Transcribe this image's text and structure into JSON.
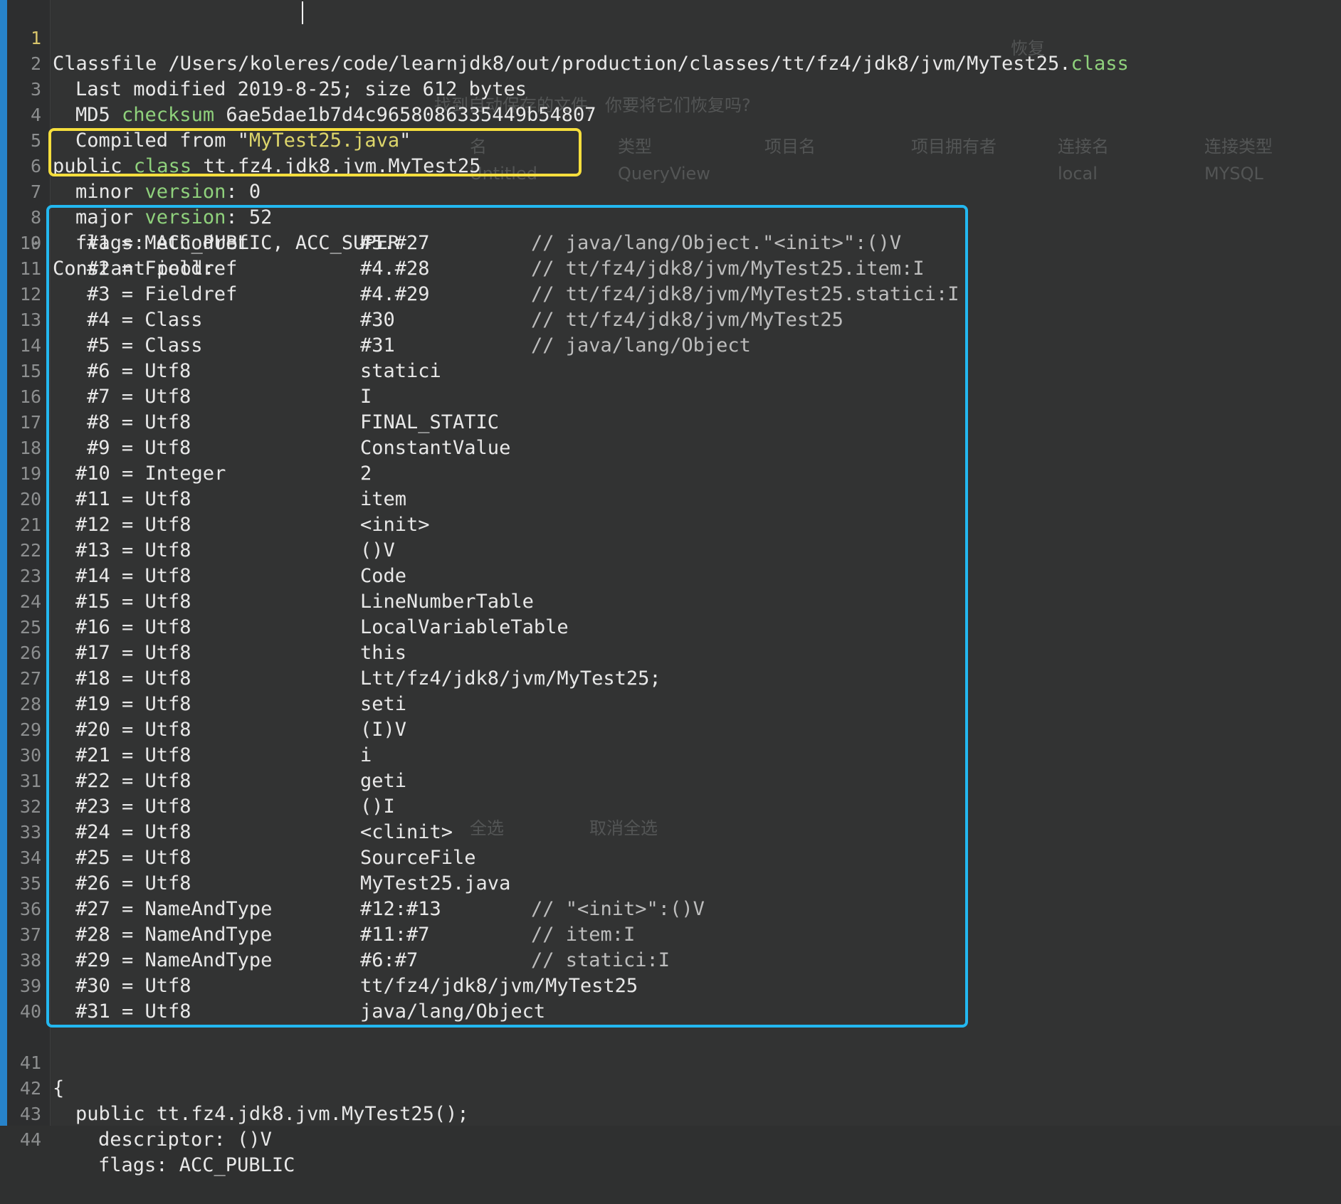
{
  "header_line": {
    "number": "1",
    "text_pre": "Classfile /Users/kole",
    "text_post": "res/code/learnjdk8/out/production/classes/tt/fz4/jdk8/jvm/MyTest25.",
    "text_kw": "class"
  },
  "meta": {
    "last_modified": "Last modified 2019-8-25; size 612 bytes",
    "md5_label": "MD5 ",
    "md5_kw": "checksum",
    "md5_value": " 6ae5dae1b7d4c9658086335449b54807",
    "compiled_pre": "Compiled from \"",
    "compiled_file": "MyTest25.java",
    "compiled_post": "\"",
    "class_pre": "public ",
    "class_kw": "class",
    "class_post": " tt.fz4.jdk8.jvm.MyTest25",
    "minor_pre": "minor ",
    "minor_kw": "version",
    "minor_post": ": 0",
    "major_pre": "major ",
    "major_kw": "version",
    "major_post": ": 52",
    "flags": "flags: ACC_PUBLIC, ACC_SUPER",
    "constant_pool": "Constant pool:"
  },
  "constant_pool": [
    {
      "idx": "#1",
      "type": "Methodref",
      "value": "#5.#27",
      "comment": "// java/lang/Object.\"<init>\":()V"
    },
    {
      "idx": "#2",
      "type": "Fieldref",
      "value": "#4.#28",
      "comment": "// tt/fz4/jdk8/jvm/MyTest25.item:I"
    },
    {
      "idx": "#3",
      "type": "Fieldref",
      "value": "#4.#29",
      "comment": "// tt/fz4/jdk8/jvm/MyTest25.statici:I"
    },
    {
      "idx": "#4",
      "type": "Class",
      "value": "#30",
      "comment": "// tt/fz4/jdk8/jvm/MyTest25"
    },
    {
      "idx": "#5",
      "type": "Class",
      "value": "#31",
      "comment": "// java/lang/Object"
    },
    {
      "idx": "#6",
      "type": "Utf8",
      "value": "statici",
      "comment": ""
    },
    {
      "idx": "#7",
      "type": "Utf8",
      "value": "I",
      "comment": ""
    },
    {
      "idx": "#8",
      "type": "Utf8",
      "value": "FINAL_STATIC",
      "comment": ""
    },
    {
      "idx": "#9",
      "type": "Utf8",
      "value": "ConstantValue",
      "comment": ""
    },
    {
      "idx": "#10",
      "type": "Integer",
      "value": "2",
      "comment": ""
    },
    {
      "idx": "#11",
      "type": "Utf8",
      "value": "item",
      "comment": ""
    },
    {
      "idx": "#12",
      "type": "Utf8",
      "value": "<init>",
      "comment": ""
    },
    {
      "idx": "#13",
      "type": "Utf8",
      "value": "()V",
      "comment": ""
    },
    {
      "idx": "#14",
      "type": "Utf8",
      "value": "Code",
      "comment": ""
    },
    {
      "idx": "#15",
      "type": "Utf8",
      "value": "LineNumberTable",
      "comment": ""
    },
    {
      "idx": "#16",
      "type": "Utf8",
      "value": "LocalVariableTable",
      "comment": ""
    },
    {
      "idx": "#17",
      "type": "Utf8",
      "value": "this",
      "comment": ""
    },
    {
      "idx": "#18",
      "type": "Utf8",
      "value": "Ltt/fz4/jdk8/jvm/MyTest25;",
      "comment": ""
    },
    {
      "idx": "#19",
      "type": "Utf8",
      "value": "seti",
      "comment": ""
    },
    {
      "idx": "#20",
      "type": "Utf8",
      "value": "(I)V",
      "comment": ""
    },
    {
      "idx": "#21",
      "type": "Utf8",
      "value": "i",
      "comment": ""
    },
    {
      "idx": "#22",
      "type": "Utf8",
      "value": "geti",
      "comment": ""
    },
    {
      "idx": "#23",
      "type": "Utf8",
      "value": "()I",
      "comment": ""
    },
    {
      "idx": "#24",
      "type": "Utf8",
      "value": "<clinit>",
      "comment": ""
    },
    {
      "idx": "#25",
      "type": "Utf8",
      "value": "SourceFile",
      "comment": ""
    },
    {
      "idx": "#26",
      "type": "Utf8",
      "value": "MyTest25.java",
      "comment": ""
    },
    {
      "idx": "#27",
      "type": "NameAndType",
      "value": "#12:#13",
      "comment": "// \"<init>\":()V"
    },
    {
      "idx": "#28",
      "type": "NameAndType",
      "value": "#11:#7",
      "comment": "// item:I"
    },
    {
      "idx": "#29",
      "type": "NameAndType",
      "value": "#6:#7",
      "comment": "// statici:I"
    },
    {
      "idx": "#30",
      "type": "Utf8",
      "value": "tt/fz4/jdk8/jvm/MyTest25",
      "comment": ""
    },
    {
      "idx": "#31",
      "type": "Utf8",
      "value": "java/lang/Object",
      "comment": ""
    }
  ],
  "tail": {
    "brace": "{",
    "ctor": "public tt.fz4.jdk8.jvm.MyTest25();",
    "descriptor": "descriptor: ()V",
    "flags": "flags: ACC_PUBLIC"
  },
  "background_dialog": {
    "question": "找到自动保存的文件。你要将它们恢复吗?",
    "col_name": "名",
    "col_type": "类型",
    "col_project": "项目名",
    "col_owner": "项目拥有者",
    "col_conn": "连接名",
    "col_conn_type": "连接类型",
    "row_name": "Untitled",
    "row_type": "QueryView",
    "row_conn": "local",
    "row_conn_type": "MYSQL",
    "select_all": "全选",
    "deselect_all": "取消全选",
    "restore": "恢复"
  },
  "colors": {
    "background": "#323333",
    "gutter": "#2d2e2f",
    "text": "#e8e8e8",
    "keyword": "#8fd17c",
    "string": "#dcd56b",
    "highlight_yellow": "#f5de3d",
    "highlight_blue": "#23b8f0"
  }
}
